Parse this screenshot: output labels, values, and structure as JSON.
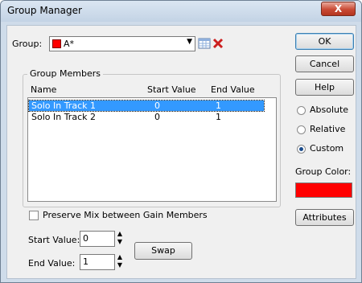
{
  "window": {
    "title": "Group Manager",
    "close_glyph": "X"
  },
  "group": {
    "label_prefix": "Group:",
    "value": "A*",
    "color": "#ff0000"
  },
  "buttons": {
    "ok": "OK",
    "cancel": "Cancel",
    "help": "Help",
    "swap": "Swap",
    "attributes": "Attributes"
  },
  "members": {
    "title": "Group Members",
    "headers": [
      "Name",
      "Start Value",
      "End Value"
    ],
    "rows": [
      {
        "name": "Solo In Track 1",
        "start": "0",
        "end": "1",
        "selected": true
      },
      {
        "name": "Solo In Track 2",
        "start": "0",
        "end": "1",
        "selected": false
      }
    ]
  },
  "mode": {
    "options": [
      "Absolute",
      "Relative",
      "Custom"
    ],
    "selected": "Custom"
  },
  "group_color_label": "Group Color:",
  "preserve_mix": {
    "label": "Preserve Mix between Gain Members",
    "checked": false
  },
  "start_value": {
    "label": "Start Value:",
    "value": "0"
  },
  "end_value": {
    "label": "End Value:",
    "value": "1"
  }
}
